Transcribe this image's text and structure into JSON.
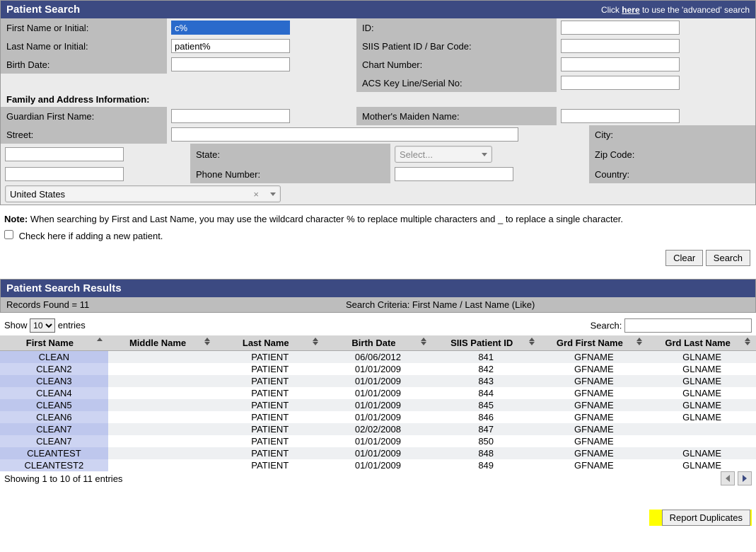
{
  "header": {
    "title": "Patient Search",
    "advanced_prefix": "Click ",
    "advanced_here": "here",
    "advanced_suffix": " to use the 'advanced' search"
  },
  "fields": {
    "first_name_label": "First Name or Initial:",
    "first_name_value": "c%",
    "last_name_label": "Last Name or Initial:",
    "last_name_value": "patient%",
    "birth_date_label": "Birth Date:",
    "birth_date_value": "",
    "id_label": "ID:",
    "id_value": "",
    "siis_label": "SIIS Patient ID / Bar Code:",
    "siis_value": "",
    "chart_label": "Chart Number:",
    "chart_value": "",
    "acs_label": "ACS Key Line/Serial No:",
    "acs_value": ""
  },
  "family_section_label": "Family and Address Information:",
  "family": {
    "guardian_first_label": "Guardian First Name:",
    "guardian_first_value": "",
    "mother_maiden_label": "Mother's Maiden Name:",
    "mother_maiden_value": "",
    "street_label": "Street:",
    "street_value": "",
    "city_label": "City:",
    "city_value": "",
    "state_label": "State:",
    "state_value": "Select...",
    "zip_label": "Zip Code:",
    "zip_value": "",
    "phone_label": "Phone Number:",
    "phone_value": "",
    "country_label": "Country:",
    "country_value": "United States"
  },
  "note": {
    "prefix": "Note:",
    "text": "  When searching by First and Last Name, you may use the wildcard character % to replace multiple characters and _ to replace a single character.",
    "checkbox_label": "Check here if adding a new patient."
  },
  "buttons": {
    "clear": "Clear",
    "search": "Search",
    "report_duplicates": "Report Duplicates"
  },
  "results": {
    "title": "Patient Search Results",
    "records_found": "Records Found = 11",
    "search_criteria": "Search Criteria: First Name / Last Name (Like)",
    "show_label_pre": "Show ",
    "show_value": "10",
    "show_label_post": " entries",
    "search_label": "Search:",
    "showing": "Showing 1 to 10 of 11 entries"
  },
  "columns": {
    "c0": "First Name",
    "c1": "Middle Name",
    "c2": "Last Name",
    "c3": "Birth Date",
    "c4": "SIIS Patient ID",
    "c5": "Grd First Name",
    "c6": "Grd Last Name"
  },
  "rows": [
    {
      "fn": "CLEAN",
      "mn": "",
      "ln": "PATIENT",
      "bd": "06/06/2012",
      "id": "841",
      "gf": "GFNAME",
      "gl": "GLNAME"
    },
    {
      "fn": "CLEAN2",
      "mn": "",
      "ln": "PATIENT",
      "bd": "01/01/2009",
      "id": "842",
      "gf": "GFNAME",
      "gl": "GLNAME"
    },
    {
      "fn": "CLEAN3",
      "mn": "",
      "ln": "PATIENT",
      "bd": "01/01/2009",
      "id": "843",
      "gf": "GFNAME",
      "gl": "GLNAME"
    },
    {
      "fn": "CLEAN4",
      "mn": "",
      "ln": "PATIENT",
      "bd": "01/01/2009",
      "id": "844",
      "gf": "GFNAME",
      "gl": "GLNAME"
    },
    {
      "fn": "CLEAN5",
      "mn": "",
      "ln": "PATIENT",
      "bd": "01/01/2009",
      "id": "845",
      "gf": "GFNAME",
      "gl": "GLNAME"
    },
    {
      "fn": "CLEAN6",
      "mn": "",
      "ln": "PATIENT",
      "bd": "01/01/2009",
      "id": "846",
      "gf": "GFNAME",
      "gl": "GLNAME"
    },
    {
      "fn": "CLEAN7",
      "mn": "",
      "ln": "PATIENT",
      "bd": "02/02/2008",
      "id": "847",
      "gf": "GFNAME",
      "gl": ""
    },
    {
      "fn": "CLEAN7",
      "mn": "",
      "ln": "PATIENT",
      "bd": "01/01/2009",
      "id": "850",
      "gf": "GFNAME",
      "gl": ""
    },
    {
      "fn": "CLEANTEST",
      "mn": "",
      "ln": "PATIENT",
      "bd": "01/01/2009",
      "id": "848",
      "gf": "GFNAME",
      "gl": "GLNAME"
    },
    {
      "fn": "CLEANTEST2",
      "mn": "",
      "ln": "PATIENT",
      "bd": "01/01/2009",
      "id": "849",
      "gf": "GFNAME",
      "gl": "GLNAME"
    }
  ]
}
